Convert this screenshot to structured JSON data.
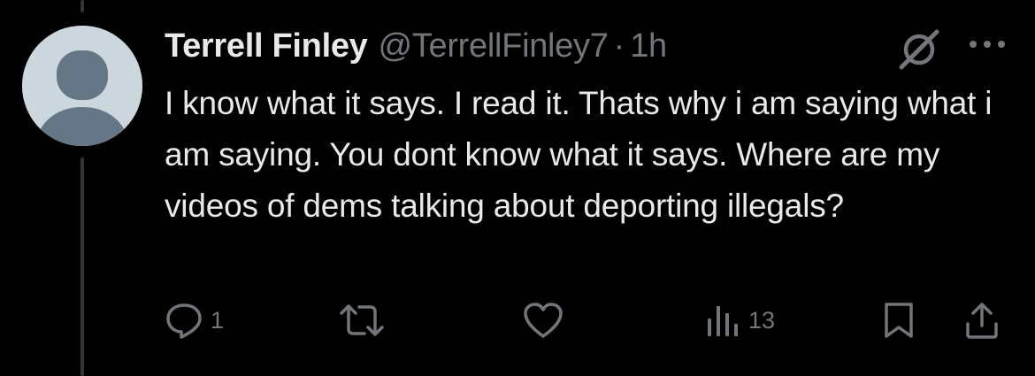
{
  "tweet": {
    "display_name": "Terrell Finley",
    "handle": "@TerrellFinley7",
    "separator": "·",
    "time": "1h",
    "text": "I know what it says. I read it. Thats why i am saying what i am saying. You dont know what it says. Where are my videos of dems talking about deporting illegals?"
  },
  "actions": {
    "reply_count": "1",
    "views_count": "13"
  },
  "icons": {
    "avatar": "default-avatar-icon",
    "grok": "grok-icon",
    "more": "more-dots-icon",
    "reply": "reply-icon",
    "retweet": "retweet-icon",
    "like": "heart-icon",
    "views": "views-chart-icon",
    "bookmark": "bookmark-icon",
    "share": "share-icon"
  },
  "colors": {
    "background": "#000000",
    "primary_text": "#e7e9ea",
    "secondary_text": "#71767b",
    "avatar_bg": "#ccd6dd",
    "avatar_figure": "#657786",
    "thread_line": "#333639"
  }
}
